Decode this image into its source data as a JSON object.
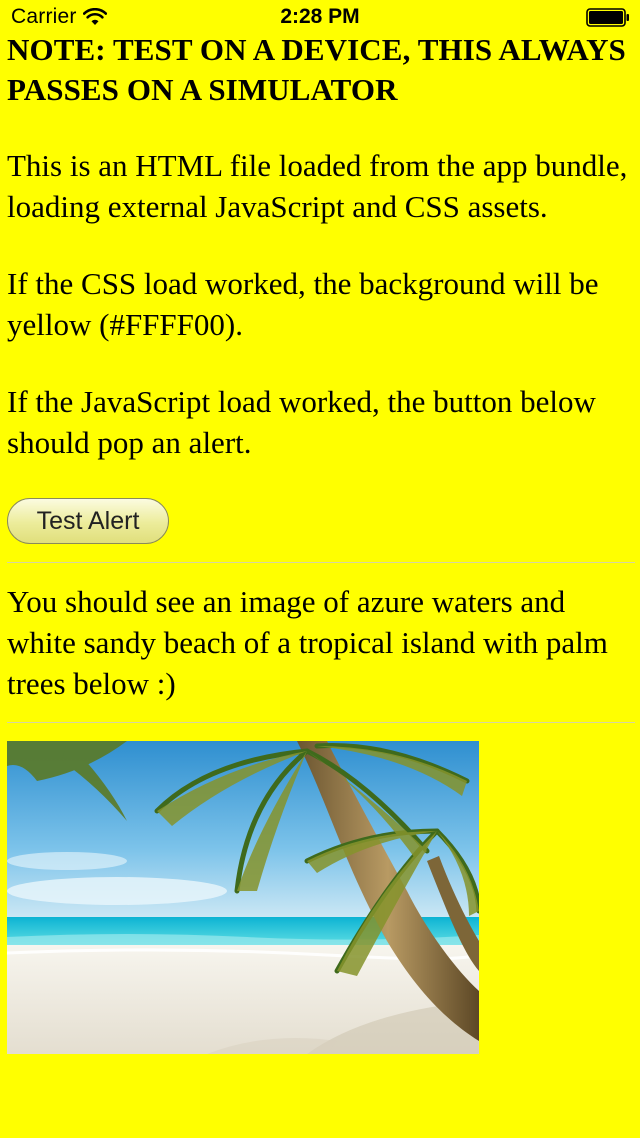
{
  "status_bar": {
    "carrier": "Carrier",
    "time": "2:28 PM",
    "wifi_icon": "wifi-icon",
    "battery_icon": "battery-icon"
  },
  "page": {
    "heading": "NOTE: TEST ON A DEVICE, THIS ALWAYS PASSES ON A SIMULATOR",
    "paragraph_intro": "This is an HTML file loaded from the app bundle, loading external JavaScript and CSS assets.",
    "paragraph_css": "If the CSS load worked, the background will be yellow (#FFFF00).",
    "paragraph_js": "If the JavaScript load worked, the button below should pop an alert.",
    "button_label": "Test Alert",
    "paragraph_image": "You should see an image of azure waters and white sandy beach of a tropical island with palm trees below :)",
    "image_icon": "beach-image"
  },
  "colors": {
    "background": "#FFFF00",
    "text": "#000000",
    "sea": "#18c6d6",
    "sky": "#3a9fd8",
    "sand": "#f1eee6"
  }
}
